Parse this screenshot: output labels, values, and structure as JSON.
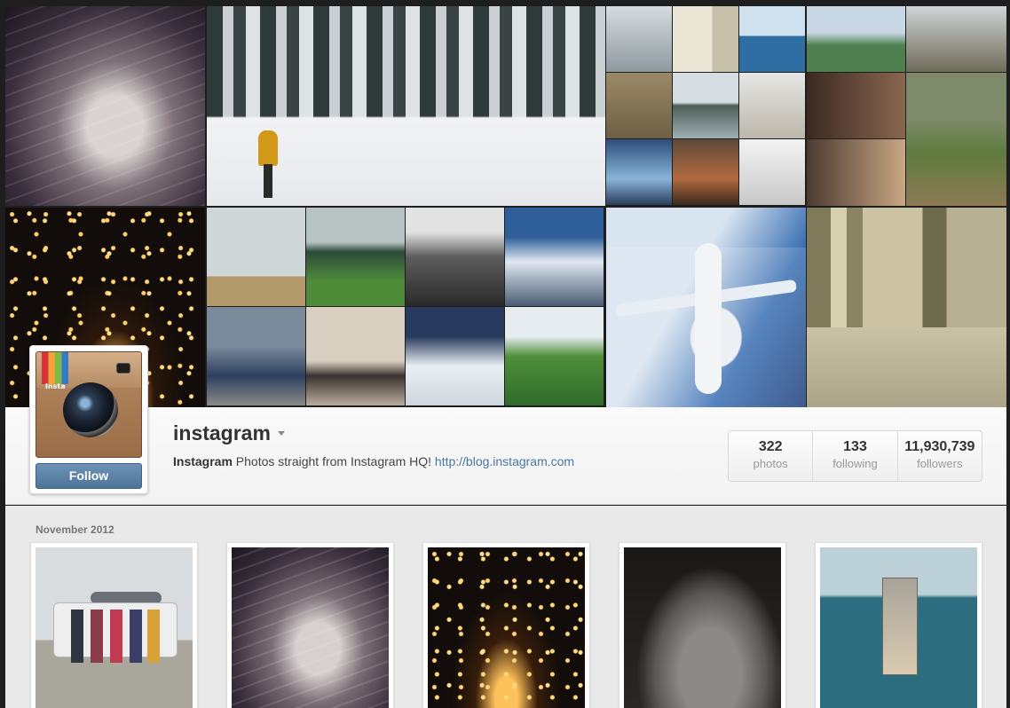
{
  "profile": {
    "username": "instagram",
    "follow_label": "Follow",
    "bio_name": "Instagram",
    "bio_text": " Photos straight from Instagram HQ! ",
    "bio_link": "http://blog.instagram.com",
    "avatar_tag": "Insta"
  },
  "stats": [
    {
      "value": "322",
      "label": "photos"
    },
    {
      "value": "133",
      "label": "following"
    },
    {
      "value": "11,930,739",
      "label": "followers"
    }
  ],
  "feed": {
    "month_label": "November 2012"
  },
  "colors": {
    "follow_button": "#567da1",
    "link": "#4a74a5",
    "page_background": "#1e1e1e"
  }
}
